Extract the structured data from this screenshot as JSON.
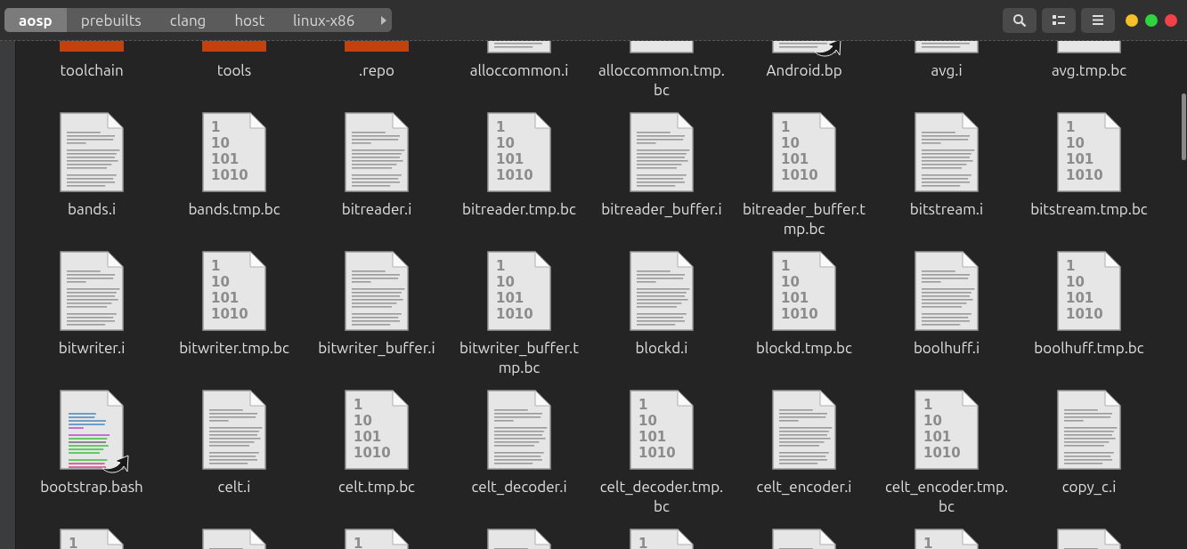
{
  "breadcrumb": [
    {
      "label": "aosp",
      "selected": true
    },
    {
      "label": "prebuilts",
      "selected": false
    },
    {
      "label": "clang",
      "selected": false
    },
    {
      "label": "host",
      "selected": false
    },
    {
      "label": "linux-x86",
      "selected": false
    }
  ],
  "toolbar": {
    "buttons": [
      {
        "kind": "search"
      },
      {
        "kind": "view"
      },
      {
        "kind": "menu"
      }
    ]
  },
  "window_controls": [
    {
      "color": "#f4bf2a"
    },
    {
      "color": "#30d440"
    },
    {
      "color": "#f0424b"
    }
  ],
  "rows": [
    [
      {
        "label": "toolchain",
        "kind": "folder",
        "link": false
      },
      {
        "label": "tools",
        "kind": "folder",
        "link": false
      },
      {
        "label": ".repo",
        "kind": "folder",
        "link": false
      },
      {
        "label": "alloccommon.i",
        "kind": "text",
        "link": false
      },
      {
        "label": "alloccommon.tmp.bc",
        "kind": "binary",
        "link": false
      },
      {
        "label": "Android.bp",
        "kind": "text",
        "link": true
      },
      {
        "label": "avg.i",
        "kind": "text",
        "link": false
      },
      {
        "label": "avg.tmp.bc",
        "kind": "binary",
        "link": false
      }
    ],
    [
      {
        "label": "bands.i",
        "kind": "text",
        "link": false
      },
      {
        "label": "bands.tmp.bc",
        "kind": "binary",
        "link": false,
        "icon_text": [
          "1",
          "10",
          "101",
          "1010"
        ]
      },
      {
        "label": "bitreader.i",
        "kind": "text",
        "link": false
      },
      {
        "label": "bitreader.tmp.bc",
        "kind": "binary",
        "link": false,
        "icon_text": [
          "1",
          "10",
          "101",
          "1010"
        ]
      },
      {
        "label": "bitreader_buffer.i",
        "kind": "text",
        "link": false
      },
      {
        "label": "bitreader_buffer.tmp.bc",
        "kind": "binary",
        "link": false,
        "icon_text": [
          "1",
          "10",
          "101",
          "1010"
        ]
      },
      {
        "label": "bitstream.i",
        "kind": "text",
        "link": false
      },
      {
        "label": "bitstream.tmp.bc",
        "kind": "binary",
        "link": false,
        "icon_text": [
          "1",
          "10",
          "101",
          "1010"
        ]
      }
    ],
    [
      {
        "label": "bitwriter.i",
        "kind": "text",
        "link": false
      },
      {
        "label": "bitwriter.tmp.bc",
        "kind": "binary",
        "link": false,
        "icon_text": [
          "1",
          "10",
          "101",
          "1010"
        ]
      },
      {
        "label": "bitwriter_buffer.i",
        "kind": "text",
        "link": false
      },
      {
        "label": "bitwriter_buffer.tmp.bc",
        "kind": "binary",
        "link": false,
        "icon_text": [
          "1",
          "10",
          "101",
          "1010"
        ]
      },
      {
        "label": "blockd.i",
        "kind": "text",
        "link": false
      },
      {
        "label": "blockd.tmp.bc",
        "kind": "binary",
        "link": false,
        "icon_text": [
          "1",
          "10",
          "101",
          "1010"
        ]
      },
      {
        "label": "boolhuff.i",
        "kind": "text",
        "link": false
      },
      {
        "label": "boolhuff.tmp.bc",
        "kind": "binary",
        "link": false,
        "icon_text": [
          "1",
          "10",
          "101",
          "1010"
        ]
      }
    ],
    [
      {
        "label": "bootstrap.bash",
        "kind": "script",
        "link": true
      },
      {
        "label": "celt.i",
        "kind": "text",
        "link": false
      },
      {
        "label": "celt.tmp.bc",
        "kind": "binary",
        "link": false,
        "icon_text": [
          "1",
          "10",
          "101",
          "1010"
        ]
      },
      {
        "label": "celt_decoder.i",
        "kind": "text",
        "link": false
      },
      {
        "label": "celt_decoder.tmp.bc",
        "kind": "binary",
        "link": false,
        "icon_text": [
          "1",
          "10",
          "101",
          "1010"
        ]
      },
      {
        "label": "celt_encoder.i",
        "kind": "text",
        "link": false
      },
      {
        "label": "celt_encoder.tmp.bc",
        "kind": "binary",
        "link": false,
        "icon_text": [
          "1",
          "10",
          "101",
          "1010"
        ]
      },
      {
        "label": "copy_c.i",
        "kind": "text",
        "link": false
      }
    ],
    [
      {
        "kind": "binary",
        "icon_text": [
          "1"
        ]
      },
      {
        "kind": "text"
      },
      {
        "kind": "binary",
        "icon_text": [
          "1"
        ]
      },
      {
        "kind": "text"
      },
      {
        "kind": "binary",
        "icon_text": [
          "1"
        ]
      },
      {
        "kind": "text"
      },
      {
        "kind": "binary",
        "icon_text": [
          "1"
        ]
      },
      {
        "kind": "text"
      }
    ]
  ]
}
